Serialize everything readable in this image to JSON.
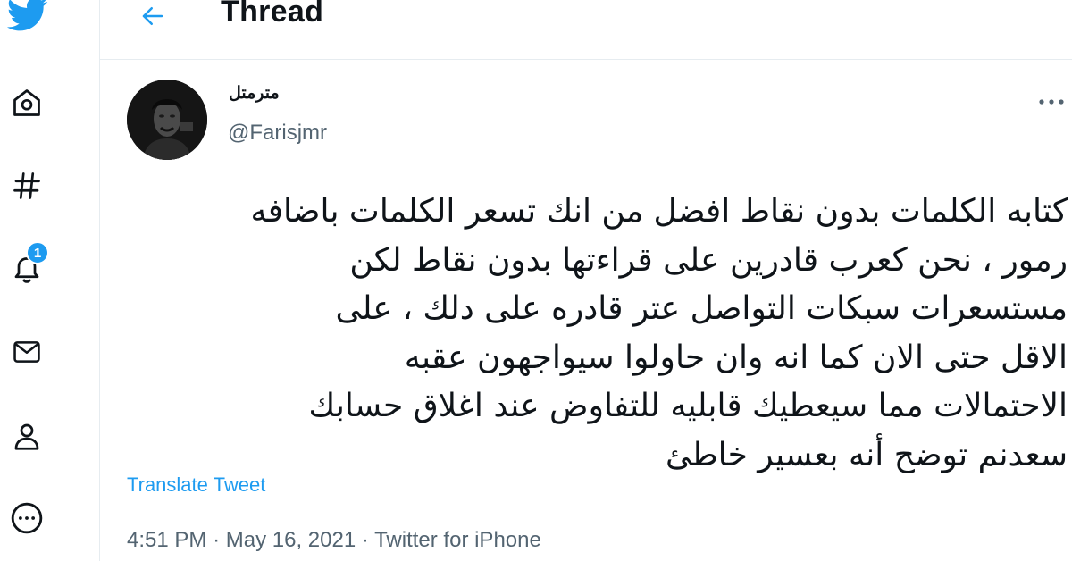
{
  "header": {
    "title": "Thread",
    "back_icon": "arrow-left-icon"
  },
  "nav": {
    "items": [
      {
        "name": "twitter-logo-icon"
      },
      {
        "name": "home-icon"
      },
      {
        "name": "explore-hashtag-icon"
      },
      {
        "name": "notifications-bell-icon",
        "badge": "1"
      },
      {
        "name": "messages-mail-icon"
      },
      {
        "name": "profile-person-icon"
      },
      {
        "name": "more-circle-icon"
      }
    ]
  },
  "tweet": {
    "display_name": "مترمتل",
    "handle": "@Farisjmr",
    "text_lines": [
      "كتابه الكلمات بدون نقاط افضل من انك تسعر الكلمات باضافه",
      "رمور ، نحن كعرب قادرين على قراءتها بدون نقاط لكن",
      "مستسعرات سبكات التواصل عتر قادره على دلك ، على",
      "الاقل حتى الان كما انه وان حاولوا سيواجهون عقبه",
      "الاحتمالات مما سيعطيك قابليه للتفاوض عند اغلاق حسابك",
      "سعدنم توضح أنه بعسير خاطئ"
    ],
    "translate_label": "Translate Tweet",
    "time": "4:51 PM",
    "separator": "·",
    "date": "May 16, 2021",
    "source": "Twitter for iPhone"
  },
  "colors": {
    "accent": "#1d9bf0",
    "secondary_text": "#536471",
    "primary_text": "#0f1419",
    "border": "#e6ecf0"
  }
}
